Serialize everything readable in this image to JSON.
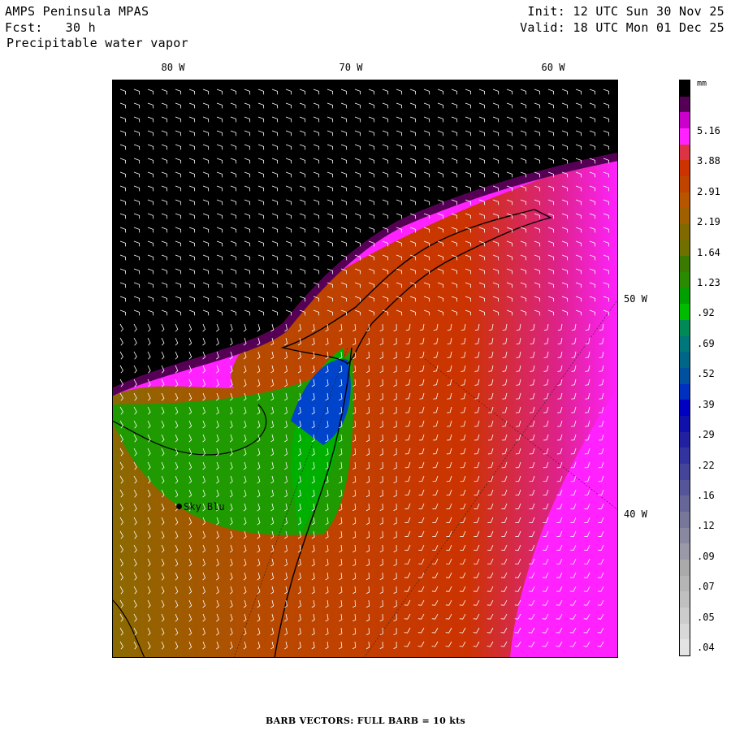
{
  "header": {
    "model": "AMPS Peninsula MPAS",
    "forecast": "Fcst:   30 h",
    "field": "Precipitable water vapor",
    "init": "Init: 12 UTC Sun 30 Nov 25",
    "valid": "Valid: 18 UTC Mon 01 Dec 25"
  },
  "longitude_labels": [
    "80 W",
    "70 W",
    "60 W"
  ],
  "latitude_labels": [
    "50 W",
    "40 W"
  ],
  "colorbar": {
    "unit": "mm",
    "labels": [
      "5.16",
      "3.88",
      "2.91",
      "2.19",
      "1.64",
      "1.23",
      ".92",
      ".69",
      ".52",
      ".39",
      ".29",
      ".22",
      ".16",
      ".12",
      ".09",
      ".07",
      ".05",
      ".04"
    ],
    "colors": [
      "#000000",
      "#550055",
      "#cc00cc",
      "#ff22ff",
      "#dd3344",
      "#cc3300",
      "#c04400",
      "#b85500",
      "#a06000",
      "#806a00",
      "#707000",
      "#3a7a00",
      "#2a8a00",
      "#00a000",
      "#00bb00",
      "#008a55",
      "#00777a",
      "#006688",
      "#0050a0",
      "#0030c0",
      "#0000c0",
      "#1010aa",
      "#2020a0",
      "#3333a0",
      "#44449a",
      "#555599",
      "#666699",
      "#777799",
      "#8888a0",
      "#9999a8",
      "#aaaaaa",
      "#b5b5b5",
      "#c0c0c0",
      "#cccccc",
      "#d8d8d8",
      "#e4e4e4"
    ]
  },
  "station": {
    "name": "Sky Blu"
  },
  "footer": "BARB VECTORS:  FULL BARB = 10 kts"
}
